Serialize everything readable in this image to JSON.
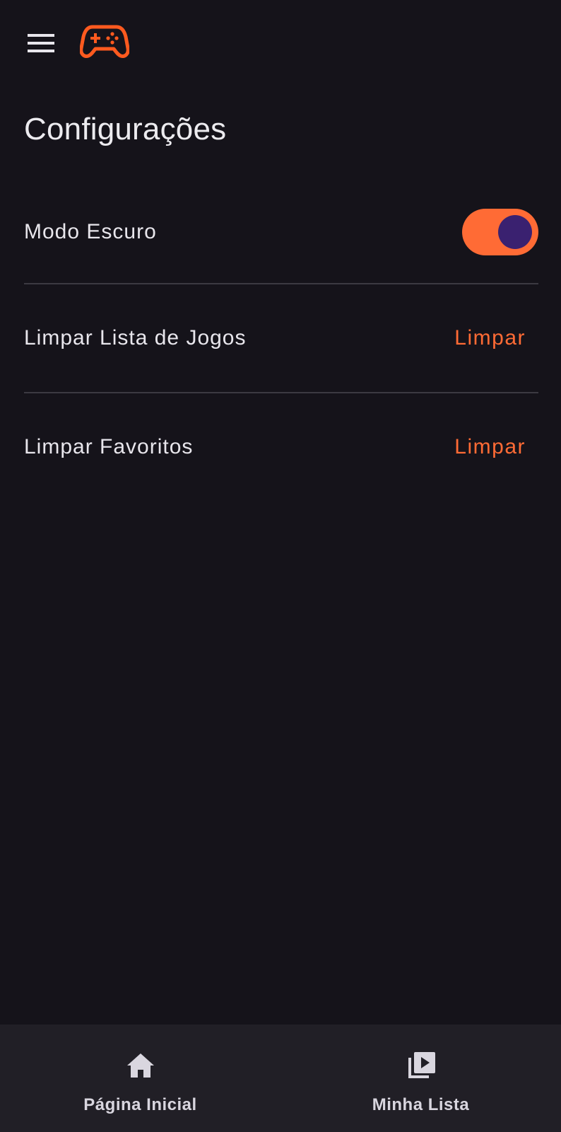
{
  "header": {
    "menu_icon": "menu-icon",
    "logo_icon": "gamepad-icon"
  },
  "page": {
    "title": "Configurações"
  },
  "settings": {
    "dark_mode": {
      "label": "Modo Escuro",
      "enabled": true
    },
    "clear_games": {
      "label": "Limpar Lista de Jogos",
      "action": "Limpar"
    },
    "clear_favorites": {
      "label": "Limpar Favoritos",
      "action": "Limpar"
    }
  },
  "bottom_nav": {
    "items": [
      {
        "label": "Página Inicial",
        "icon": "home-icon"
      },
      {
        "label": "Minha Lista",
        "icon": "video-library-icon"
      }
    ]
  },
  "colors": {
    "background": "#15131a",
    "accent": "#ff6b35",
    "toggle_knob": "#3a2170",
    "nav_background": "#211f26",
    "divider": "#3c3a42"
  }
}
